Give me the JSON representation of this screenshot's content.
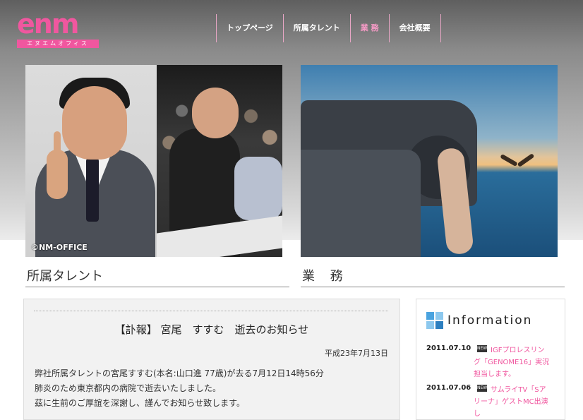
{
  "header": {
    "logo": {
      "text": "enm",
      "subtitle": "エヌエムオフィス"
    },
    "nav": [
      {
        "label": "トップページ",
        "active": false
      },
      {
        "label": "所属タレント",
        "active": false
      },
      {
        "label": "業 務",
        "active": true
      },
      {
        "label": "会社概要",
        "active": false
      }
    ]
  },
  "hero": {
    "copyright": "©NM-OFFICE"
  },
  "sections": {
    "talent_title": "所属タレント",
    "business_title": "業 務"
  },
  "news": {
    "title": "【訃報】 宮尾　すすむ　逝去のお知らせ",
    "date": "平成23年7月13日",
    "lines": [
      "弊社所属タレントの宮尾すすむ(本名:山口進 77歳)が去る7月12日14時56分",
      "肺炎のため東京都内の病院で逝去いたしました。",
      "茲に生前のご厚誼を深謝し、謹んでお知らせ致します。"
    ]
  },
  "information": {
    "title": "Information",
    "badge": "NEW",
    "items": [
      {
        "date": "2011.07.10",
        "text": "IGFプロレスリング「GENOME16」実況担当します。"
      },
      {
        "date": "2011.07.06",
        "text": "サムライTV「Sアリーナ」ゲストMC出演し"
      }
    ]
  },
  "colors": {
    "brand_pink": "#f0579f",
    "header_gray": "#5f5f5f"
  }
}
